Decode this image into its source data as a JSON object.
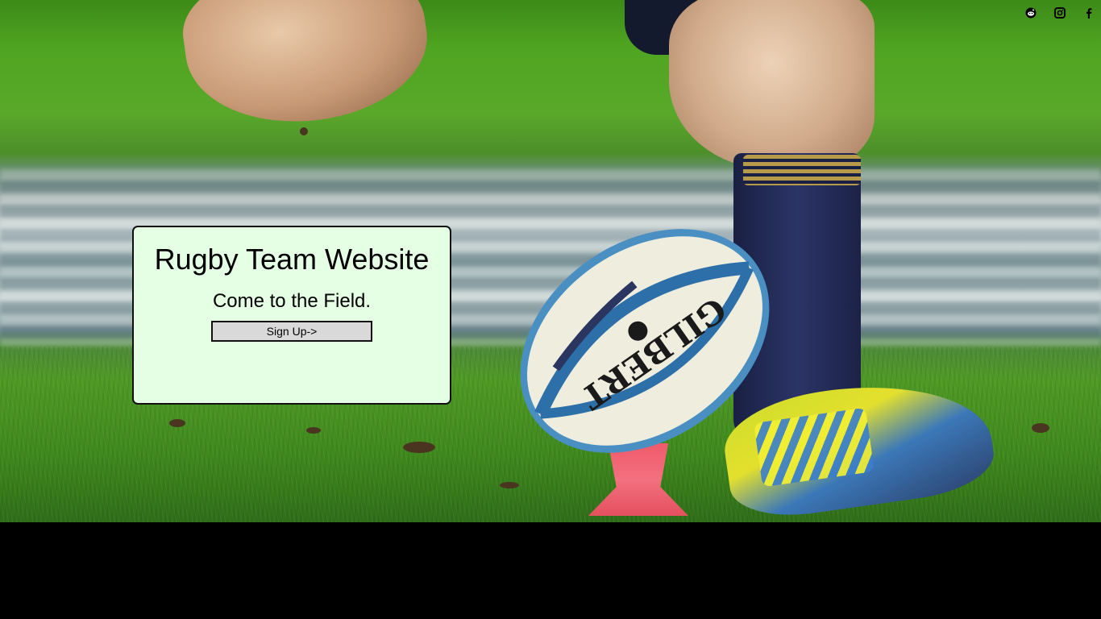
{
  "card": {
    "title": "Rugby Team Website",
    "subtitle": "Come to the Field.",
    "signup_label": "Sign Up->"
  },
  "ball": {
    "brand": "GILBERT"
  },
  "social": {
    "icons": [
      "reddit-icon",
      "instagram-icon",
      "facebook-icon"
    ]
  },
  "colors": {
    "card_background": "#e4ffe4",
    "button_background": "#d9d9d9",
    "footer": "#000000"
  }
}
